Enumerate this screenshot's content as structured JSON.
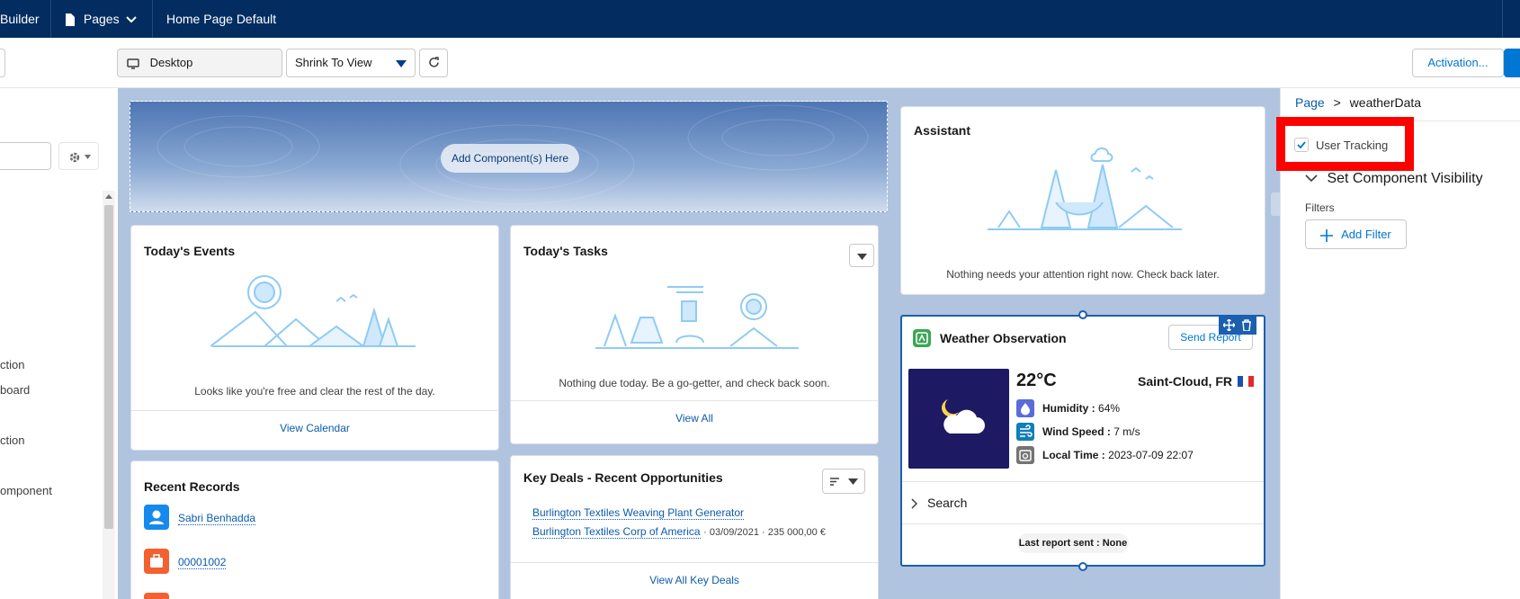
{
  "topbar": {
    "builder_label": "Builder",
    "pages_label": "Pages",
    "page_title": "Home Page Default"
  },
  "toolbar": {
    "device_label": "Desktop",
    "zoom_select": "Shrink To View",
    "activation_label": "Activation..."
  },
  "left_panel": {
    "items": [
      "ction",
      "board",
      "ction",
      "omponent"
    ]
  },
  "canvas": {
    "header_region": {
      "add_component_label": "Add Component(s) Here"
    },
    "events_card": {
      "title": "Today's Events",
      "empty_text": "Looks like you're free and clear the rest of the day.",
      "footer_link": "View Calendar"
    },
    "tasks_card": {
      "title": "Today's Tasks",
      "empty_text": "Nothing due today. Be a go-getter, and check back soon.",
      "footer_link": "View All"
    },
    "assistant_card": {
      "title": "Assistant",
      "empty_text": "Nothing needs your attention right now. Check back later."
    },
    "weather_card": {
      "title": "Weather Observation",
      "send_report_label": "Send Report",
      "temperature": "22°C",
      "location": "Saint-Cloud, FR",
      "humidity_label": "Humidity :",
      "humidity_value": "64%",
      "wind_label": "Wind Speed :",
      "wind_value": "7 m/s",
      "time_label": "Local Time :",
      "time_value": "2023-07-09 22:07",
      "search_label": "Search",
      "last_report": "Last report sent : None"
    },
    "recent_records_card": {
      "title": "Recent Records",
      "records": [
        "Sabri Benhadda",
        "00001002"
      ]
    },
    "key_deals_card": {
      "title": "Key Deals - Recent Opportunities",
      "deal_name": "Burlington Textiles Weaving Plant Generator",
      "deal_account": "Burlington Textiles Corp of America",
      "deal_meta": "· 03/09/2021 · 235 000,00 €",
      "footer_link": "View All Key Deals"
    }
  },
  "right_panel": {
    "breadcrumb_root": "Page",
    "breadcrumb_sep": ">",
    "breadcrumb_current": "weatherData",
    "user_tracking_label": "User Tracking",
    "visibility_label": "Set Component Visibility",
    "filters_label": "Filters",
    "add_filter_label": "Add Filter"
  },
  "colors": {
    "brand_navy": "#032d60",
    "link_blue": "#0b5cab",
    "accent_blue": "#0176d3",
    "highlight_red": "#ff0000",
    "weather_tile": "#1d1a63"
  }
}
